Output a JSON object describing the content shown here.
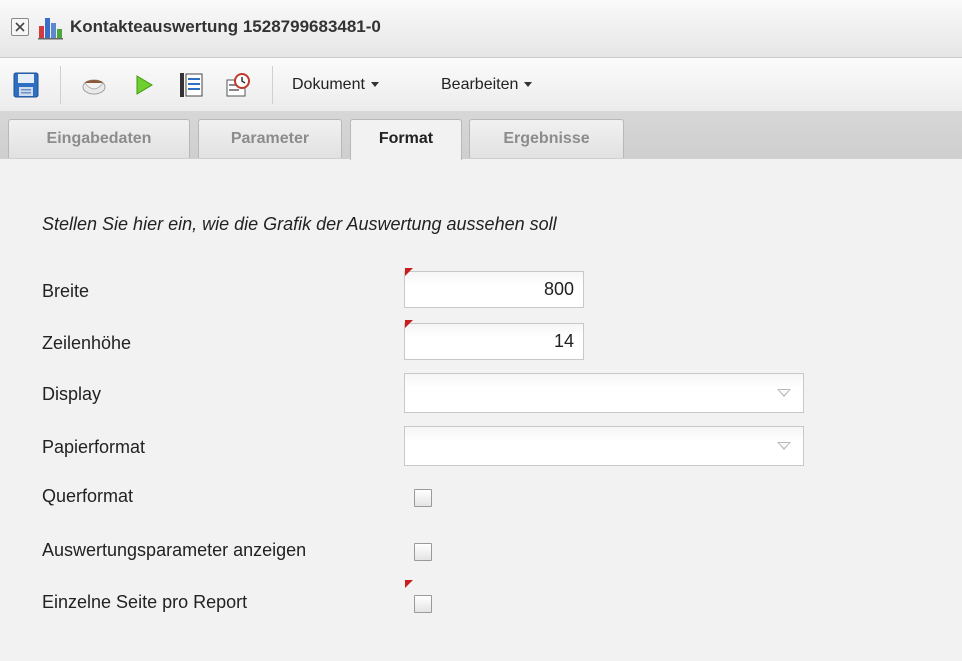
{
  "window": {
    "title": "Kontakteauswertung 1528799683481-0",
    "close_icon": "close-icon",
    "app_icon": "bar-chart-icon"
  },
  "toolbar": {
    "icons": [
      "save-icon",
      "coffee-cup-icon",
      "run-arrow-icon",
      "document-list-icon",
      "scheduler-icon"
    ],
    "menus": [
      {
        "label": "Dokument"
      },
      {
        "label": "Bearbeiten"
      }
    ]
  },
  "tabs": [
    {
      "label": "Eingabedaten",
      "active": false
    },
    {
      "label": "Parameter",
      "active": false
    },
    {
      "label": "Format",
      "active": true
    },
    {
      "label": "Ergebnisse",
      "active": false
    }
  ],
  "form": {
    "intro": "Stellen Sie hier ein, wie die Grafik der Auswertung aussehen soll",
    "breite": {
      "label": "Breite",
      "value": "800",
      "required": true
    },
    "zeilenhoehe": {
      "label": "Zeilenhöhe",
      "value": "14",
      "required": true
    },
    "display": {
      "label": "Display",
      "value": ""
    },
    "papierformat": {
      "label": "Papierformat",
      "value": ""
    },
    "querformat": {
      "label": "Querformat",
      "checked": false
    },
    "auswertungsparameter": {
      "label": "Auswertungsparameter anzeigen",
      "checked": false
    },
    "einzelne_seite": {
      "label": "Einzelne Seite pro Report",
      "checked": false,
      "required": true
    }
  },
  "colors": {
    "required_marker": "#c81e1e",
    "chart_blue": "#3a6fc9",
    "chart_red": "#d43a3a",
    "chart_green": "#4aa63a"
  }
}
